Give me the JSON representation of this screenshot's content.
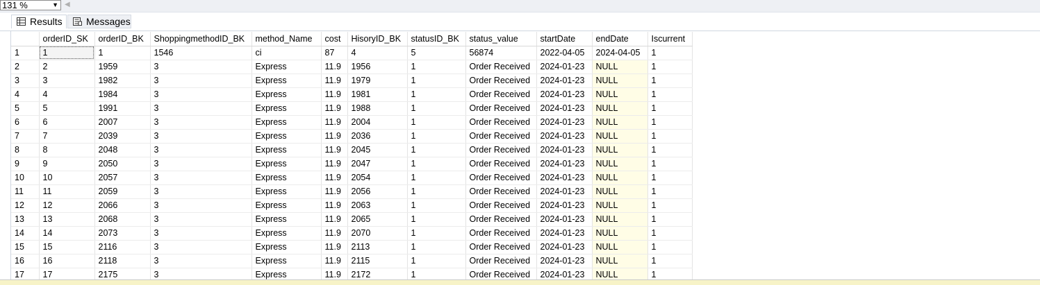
{
  "zoom": {
    "value": "131 %"
  },
  "tabs": [
    {
      "label": "Results",
      "icon": "grid-icon"
    },
    {
      "label": "Messages",
      "icon": "messages-icon"
    }
  ],
  "columns": [
    "orderID_SK",
    "orderID_BK",
    "ShoppingmethodID_BK",
    "method_Name",
    "cost",
    "HisoryID_BK",
    "statusID_BK",
    "status_value",
    "startDate",
    "endDate",
    "Iscurrent"
  ],
  "rows": [
    {
      "n": "1",
      "cells": [
        "1",
        "1",
        "1546",
        "ci",
        "87",
        "4",
        "5",
        "56874",
        "2022-04-05",
        "2024-04-05",
        "1"
      ]
    },
    {
      "n": "2",
      "cells": [
        "2",
        "1959",
        "3",
        "Express",
        "11.9",
        "1956",
        "1",
        "Order Received",
        "2024-01-23",
        "NULL",
        "1"
      ]
    },
    {
      "n": "3",
      "cells": [
        "3",
        "1982",
        "3",
        "Express",
        "11.9",
        "1979",
        "1",
        "Order Received",
        "2024-01-23",
        "NULL",
        "1"
      ]
    },
    {
      "n": "4",
      "cells": [
        "4",
        "1984",
        "3",
        "Express",
        "11.9",
        "1981",
        "1",
        "Order Received",
        "2024-01-23",
        "NULL",
        "1"
      ]
    },
    {
      "n": "5",
      "cells": [
        "5",
        "1991",
        "3",
        "Express",
        "11.9",
        "1988",
        "1",
        "Order Received",
        "2024-01-23",
        "NULL",
        "1"
      ]
    },
    {
      "n": "6",
      "cells": [
        "6",
        "2007",
        "3",
        "Express",
        "11.9",
        "2004",
        "1",
        "Order Received",
        "2024-01-23",
        "NULL",
        "1"
      ]
    },
    {
      "n": "7",
      "cells": [
        "7",
        "2039",
        "3",
        "Express",
        "11.9",
        "2036",
        "1",
        "Order Received",
        "2024-01-23",
        "NULL",
        "1"
      ]
    },
    {
      "n": "8",
      "cells": [
        "8",
        "2048",
        "3",
        "Express",
        "11.9",
        "2045",
        "1",
        "Order Received",
        "2024-01-23",
        "NULL",
        "1"
      ]
    },
    {
      "n": "9",
      "cells": [
        "9",
        "2050",
        "3",
        "Express",
        "11.9",
        "2047",
        "1",
        "Order Received",
        "2024-01-23",
        "NULL",
        "1"
      ]
    },
    {
      "n": "10",
      "cells": [
        "10",
        "2057",
        "3",
        "Express",
        "11.9",
        "2054",
        "1",
        "Order Received",
        "2024-01-23",
        "NULL",
        "1"
      ]
    },
    {
      "n": "11",
      "cells": [
        "11",
        "2059",
        "3",
        "Express",
        "11.9",
        "2056",
        "1",
        "Order Received",
        "2024-01-23",
        "NULL",
        "1"
      ]
    },
    {
      "n": "12",
      "cells": [
        "12",
        "2066",
        "3",
        "Express",
        "11.9",
        "2063",
        "1",
        "Order Received",
        "2024-01-23",
        "NULL",
        "1"
      ]
    },
    {
      "n": "13",
      "cells": [
        "13",
        "2068",
        "3",
        "Express",
        "11.9",
        "2065",
        "1",
        "Order Received",
        "2024-01-23",
        "NULL",
        "1"
      ]
    },
    {
      "n": "14",
      "cells": [
        "14",
        "2073",
        "3",
        "Express",
        "11.9",
        "2070",
        "1",
        "Order Received",
        "2024-01-23",
        "NULL",
        "1"
      ]
    },
    {
      "n": "15",
      "cells": [
        "15",
        "2116",
        "3",
        "Express",
        "11.9",
        "2113",
        "1",
        "Order Received",
        "2024-01-23",
        "NULL",
        "1"
      ]
    },
    {
      "n": "16",
      "cells": [
        "16",
        "2118",
        "3",
        "Express",
        "11.9",
        "2115",
        "1",
        "Order Received",
        "2024-01-23",
        "NULL",
        "1"
      ]
    },
    {
      "n": "17",
      "cells": [
        "17",
        "2175",
        "3",
        "Express",
        "11.9",
        "2172",
        "1",
        "Order Received",
        "2024-01-23",
        "NULL",
        "1"
      ]
    }
  ]
}
